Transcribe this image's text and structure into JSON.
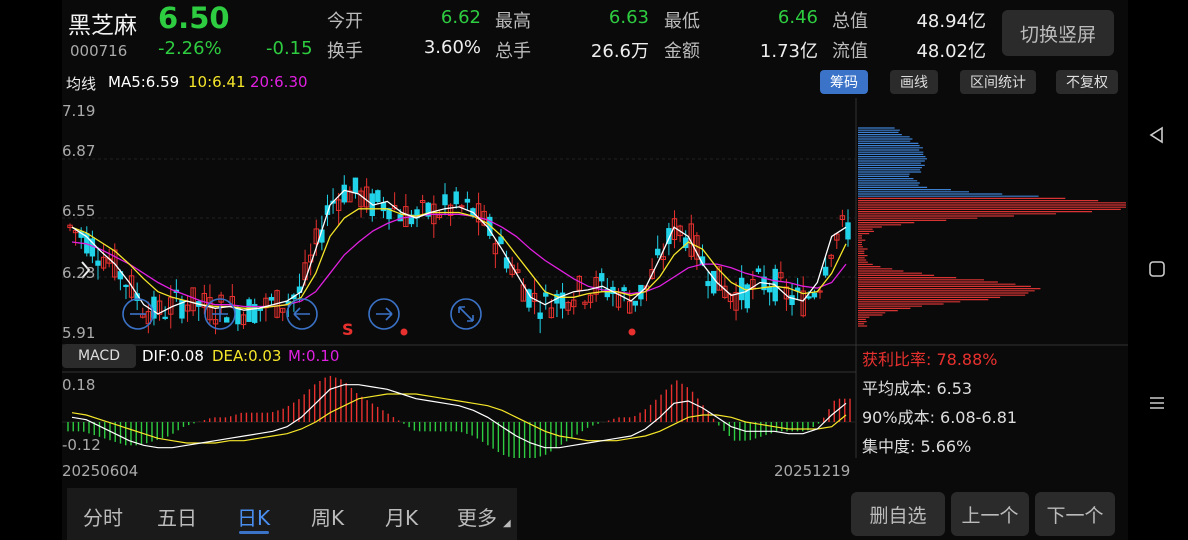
{
  "stock": {
    "name": "黑芝麻",
    "price": "6.50",
    "code": "000716",
    "change_pct": "-2.26%",
    "change": "-0.15"
  },
  "stats": [
    {
      "label": "今开",
      "value": "6.62",
      "color": "#2ecc40"
    },
    {
      "label": "最高",
      "value": "6.63",
      "color": "#2ecc40"
    },
    {
      "label": "最低",
      "value": "6.46",
      "color": "#2ecc40"
    },
    {
      "label": "总值",
      "value": "48.94亿",
      "color": "#eeeeee"
    },
    {
      "label": "换手",
      "value": "3.60%",
      "color": "#eeeeee"
    },
    {
      "label": "总手",
      "value": "26.6万",
      "color": "#eeeeee"
    },
    {
      "label": "金额",
      "value": "1.73亿",
      "color": "#eeeeee"
    },
    {
      "label": "流值",
      "value": "48.02亿",
      "color": "#eeeeee"
    }
  ],
  "switch_label": "切换竖屏",
  "ma": {
    "label": "均线",
    "ma5": "MA5:6.59",
    "ma10": "10:6.41",
    "ma20": "20:6.30",
    "colors": {
      "ma5": "#ffffff",
      "ma10": "#f5e62a",
      "ma20": "#e020e0"
    }
  },
  "tools": [
    {
      "label": "筹码",
      "active": true
    },
    {
      "label": "画线",
      "active": false
    },
    {
      "label": "区间统计",
      "active": false
    },
    {
      "label": "不复权",
      "active": false
    }
  ],
  "price_axis": [
    "7.19",
    "6.87",
    "6.55",
    "6.23",
    "5.91"
  ],
  "macd": {
    "label": "MACD",
    "dif": "DIF:0.08",
    "dea": "DEA:0.03",
    "m": "M:0.10",
    "axis_top": "0.18",
    "axis_bottom": "-0.12"
  },
  "chips": {
    "profit": "获利比率: 78.88%",
    "avg_cost": "平均成本: 6.53",
    "cost90": "90%成本: 6.08-6.81",
    "concentration": "集中度: 5.66%"
  },
  "dates": {
    "start": "20250604",
    "end": "20251219"
  },
  "marker": "S",
  "tabs": [
    {
      "label": "分时",
      "active": false
    },
    {
      "label": "五日",
      "active": false
    },
    {
      "label": "日K",
      "active": true
    },
    {
      "label": "周K",
      "active": false
    },
    {
      "label": "月K",
      "active": false
    },
    {
      "label": "更多",
      "active": false
    }
  ],
  "actions": {
    "delete": "删自选",
    "prev": "上一个",
    "next": "下一个"
  },
  "colors": {
    "up": "#e8312f",
    "down": "#21d3e8",
    "green": "#2ecc40",
    "accent": "#3b73c8",
    "chip_high": "#3d7fd1",
    "chip_low": "#d83434"
  },
  "chart_data": {
    "type": "candlestick",
    "x_range": [
      "20250604",
      "20251219"
    ],
    "ylim": [
      5.91,
      7.19
    ],
    "ma5": [
      6.5,
      6.45,
      6.37,
      6.3,
      6.2,
      6.08,
      6.03,
      6.07,
      6.1,
      6.08,
      6.06,
      6.07,
      6.05,
      6.06,
      6.08,
      6.1,
      6.15,
      6.38,
      6.62,
      6.7,
      6.68,
      6.62,
      6.64,
      6.58,
      6.55,
      6.58,
      6.6,
      6.61,
      6.58,
      6.5,
      6.38,
      6.25,
      6.12,
      6.08,
      6.12,
      6.15,
      6.16,
      6.18,
      6.14,
      6.1,
      6.17,
      6.33,
      6.5,
      6.45,
      6.3,
      6.2,
      6.13,
      6.15,
      6.2,
      6.19,
      6.12,
      6.1,
      6.2,
      6.45,
      6.5
    ],
    "ma10": [
      6.5,
      6.47,
      6.42,
      6.37,
      6.3,
      6.22,
      6.15,
      6.12,
      6.1,
      6.08,
      6.07,
      6.07,
      6.06,
      6.06,
      6.07,
      6.08,
      6.12,
      6.25,
      6.45,
      6.55,
      6.6,
      6.6,
      6.6,
      6.57,
      6.56,
      6.58,
      6.58,
      6.58,
      6.56,
      6.52,
      6.45,
      6.35,
      6.25,
      6.15,
      6.12,
      6.12,
      6.14,
      6.15,
      6.15,
      6.13,
      6.15,
      6.23,
      6.35,
      6.42,
      6.38,
      6.28,
      6.2,
      6.16,
      6.17,
      6.18,
      6.17,
      6.14,
      6.15,
      6.25,
      6.41
    ],
    "ma20": [
      6.42,
      6.41,
      6.38,
      6.34,
      6.3,
      6.25,
      6.2,
      6.16,
      6.13,
      6.1,
      6.08,
      6.08,
      6.07,
      6.07,
      6.07,
      6.08,
      6.1,
      6.15,
      6.25,
      6.35,
      6.42,
      6.48,
      6.52,
      6.55,
      6.56,
      6.57,
      6.57,
      6.57,
      6.56,
      6.54,
      6.5,
      6.45,
      6.38,
      6.32,
      6.27,
      6.22,
      6.18,
      6.16,
      6.15,
      6.14,
      6.15,
      6.18,
      6.23,
      6.28,
      6.3,
      6.3,
      6.28,
      6.25,
      6.23,
      6.21,
      6.2,
      6.18,
      6.17,
      6.2,
      6.3
    ],
    "macd_dif": [
      0.02,
      0.01,
      -0.02,
      -0.05,
      -0.08,
      -0.1,
      -0.11,
      -0.11,
      -0.1,
      -0.09,
      -0.08,
      -0.07,
      -0.06,
      -0.05,
      -0.04,
      -0.02,
      0.02,
      0.08,
      0.14,
      0.16,
      0.16,
      0.15,
      0.14,
      0.12,
      0.1,
      0.09,
      0.08,
      0.07,
      0.05,
      0.02,
      -0.02,
      -0.06,
      -0.09,
      -0.11,
      -0.11,
      -0.1,
      -0.09,
      -0.08,
      -0.07,
      -0.06,
      -0.03,
      0.02,
      0.08,
      0.09,
      0.06,
      0.02,
      -0.02,
      -0.04,
      -0.04,
      -0.04,
      -0.05,
      -0.05,
      -0.03,
      0.03,
      0.08
    ],
    "macd_dea": [
      0.04,
      0.03,
      0.01,
      -0.01,
      -0.03,
      -0.05,
      -0.07,
      -0.08,
      -0.09,
      -0.09,
      -0.09,
      -0.08,
      -0.08,
      -0.07,
      -0.06,
      -0.05,
      -0.03,
      0.0,
      0.04,
      0.07,
      0.1,
      0.11,
      0.12,
      0.12,
      0.12,
      0.11,
      0.1,
      0.09,
      0.08,
      0.07,
      0.05,
      0.02,
      -0.01,
      -0.04,
      -0.06,
      -0.07,
      -0.08,
      -0.08,
      -0.08,
      -0.07,
      -0.06,
      -0.04,
      -0.01,
      0.02,
      0.03,
      0.03,
      0.02,
      0.0,
      -0.01,
      -0.02,
      -0.03,
      -0.03,
      -0.03,
      -0.02,
      0.03
    ]
  }
}
